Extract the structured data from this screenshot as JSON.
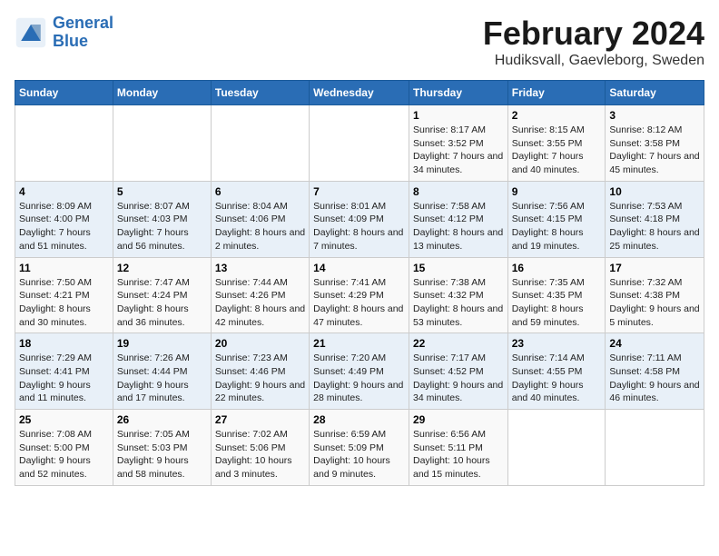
{
  "header": {
    "logo_line1": "General",
    "logo_line2": "Blue",
    "month": "February 2024",
    "location": "Hudiksvall, Gaevleborg, Sweden"
  },
  "weekdays": [
    "Sunday",
    "Monday",
    "Tuesday",
    "Wednesday",
    "Thursday",
    "Friday",
    "Saturday"
  ],
  "weeks": [
    [
      {
        "day": "",
        "detail": ""
      },
      {
        "day": "",
        "detail": ""
      },
      {
        "day": "",
        "detail": ""
      },
      {
        "day": "",
        "detail": ""
      },
      {
        "day": "1",
        "detail": "Sunrise: 8:17 AM\nSunset: 3:52 PM\nDaylight: 7 hours\nand 34 minutes."
      },
      {
        "day": "2",
        "detail": "Sunrise: 8:15 AM\nSunset: 3:55 PM\nDaylight: 7 hours\nand 40 minutes."
      },
      {
        "day": "3",
        "detail": "Sunrise: 8:12 AM\nSunset: 3:58 PM\nDaylight: 7 hours\nand 45 minutes."
      }
    ],
    [
      {
        "day": "4",
        "detail": "Sunrise: 8:09 AM\nSunset: 4:00 PM\nDaylight: 7 hours\nand 51 minutes."
      },
      {
        "day": "5",
        "detail": "Sunrise: 8:07 AM\nSunset: 4:03 PM\nDaylight: 7 hours\nand 56 minutes."
      },
      {
        "day": "6",
        "detail": "Sunrise: 8:04 AM\nSunset: 4:06 PM\nDaylight: 8 hours\nand 2 minutes."
      },
      {
        "day": "7",
        "detail": "Sunrise: 8:01 AM\nSunset: 4:09 PM\nDaylight: 8 hours\nand 7 minutes."
      },
      {
        "day": "8",
        "detail": "Sunrise: 7:58 AM\nSunset: 4:12 PM\nDaylight: 8 hours\nand 13 minutes."
      },
      {
        "day": "9",
        "detail": "Sunrise: 7:56 AM\nSunset: 4:15 PM\nDaylight: 8 hours\nand 19 minutes."
      },
      {
        "day": "10",
        "detail": "Sunrise: 7:53 AM\nSunset: 4:18 PM\nDaylight: 8 hours\nand 25 minutes."
      }
    ],
    [
      {
        "day": "11",
        "detail": "Sunrise: 7:50 AM\nSunset: 4:21 PM\nDaylight: 8 hours\nand 30 minutes."
      },
      {
        "day": "12",
        "detail": "Sunrise: 7:47 AM\nSunset: 4:24 PM\nDaylight: 8 hours\nand 36 minutes."
      },
      {
        "day": "13",
        "detail": "Sunrise: 7:44 AM\nSunset: 4:26 PM\nDaylight: 8 hours\nand 42 minutes."
      },
      {
        "day": "14",
        "detail": "Sunrise: 7:41 AM\nSunset: 4:29 PM\nDaylight: 8 hours\nand 47 minutes."
      },
      {
        "day": "15",
        "detail": "Sunrise: 7:38 AM\nSunset: 4:32 PM\nDaylight: 8 hours\nand 53 minutes."
      },
      {
        "day": "16",
        "detail": "Sunrise: 7:35 AM\nSunset: 4:35 PM\nDaylight: 8 hours\nand 59 minutes."
      },
      {
        "day": "17",
        "detail": "Sunrise: 7:32 AM\nSunset: 4:38 PM\nDaylight: 9 hours\nand 5 minutes."
      }
    ],
    [
      {
        "day": "18",
        "detail": "Sunrise: 7:29 AM\nSunset: 4:41 PM\nDaylight: 9 hours\nand 11 minutes."
      },
      {
        "day": "19",
        "detail": "Sunrise: 7:26 AM\nSunset: 4:44 PM\nDaylight: 9 hours\nand 17 minutes."
      },
      {
        "day": "20",
        "detail": "Sunrise: 7:23 AM\nSunset: 4:46 PM\nDaylight: 9 hours\nand 22 minutes."
      },
      {
        "day": "21",
        "detail": "Sunrise: 7:20 AM\nSunset: 4:49 PM\nDaylight: 9 hours\nand 28 minutes."
      },
      {
        "day": "22",
        "detail": "Sunrise: 7:17 AM\nSunset: 4:52 PM\nDaylight: 9 hours\nand 34 minutes."
      },
      {
        "day": "23",
        "detail": "Sunrise: 7:14 AM\nSunset: 4:55 PM\nDaylight: 9 hours\nand 40 minutes."
      },
      {
        "day": "24",
        "detail": "Sunrise: 7:11 AM\nSunset: 4:58 PM\nDaylight: 9 hours\nand 46 minutes."
      }
    ],
    [
      {
        "day": "25",
        "detail": "Sunrise: 7:08 AM\nSunset: 5:00 PM\nDaylight: 9 hours\nand 52 minutes."
      },
      {
        "day": "26",
        "detail": "Sunrise: 7:05 AM\nSunset: 5:03 PM\nDaylight: 9 hours\nand 58 minutes."
      },
      {
        "day": "27",
        "detail": "Sunrise: 7:02 AM\nSunset: 5:06 PM\nDaylight: 10 hours\nand 3 minutes."
      },
      {
        "day": "28",
        "detail": "Sunrise: 6:59 AM\nSunset: 5:09 PM\nDaylight: 10 hours\nand 9 minutes."
      },
      {
        "day": "29",
        "detail": "Sunrise: 6:56 AM\nSunset: 5:11 PM\nDaylight: 10 hours\nand 15 minutes."
      },
      {
        "day": "",
        "detail": ""
      },
      {
        "day": "",
        "detail": ""
      }
    ]
  ]
}
